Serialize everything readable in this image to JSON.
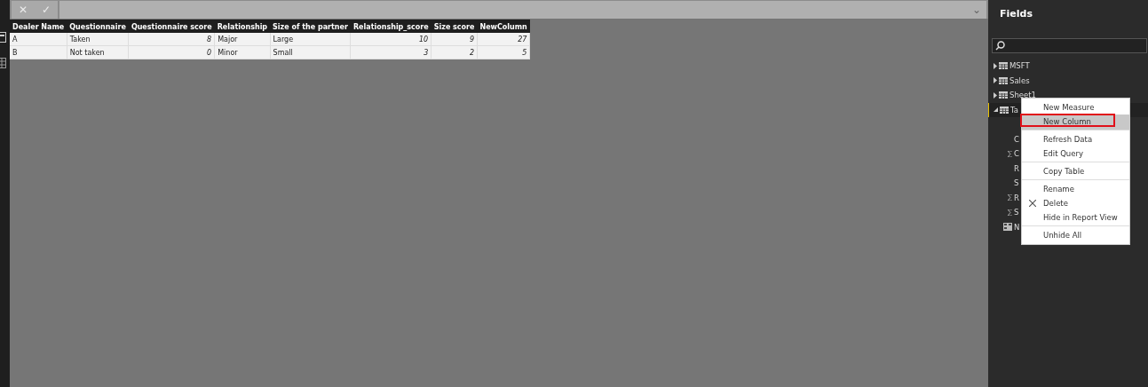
{
  "formula_bar": {
    "cancel": "✕",
    "commit": "✓",
    "expand": "⌄"
  },
  "table": {
    "columns": [
      {
        "label": "Dealer Name",
        "numeric": false
      },
      {
        "label": "Questionnaire",
        "numeric": false
      },
      {
        "label": "Questionnaire score",
        "numeric": true
      },
      {
        "label": "Relationship",
        "numeric": false
      },
      {
        "label": "Size of the partner",
        "numeric": false
      },
      {
        "label": "Relationship_score",
        "numeric": true
      },
      {
        "label": "Size score",
        "numeric": true
      },
      {
        "label": "NewColumn",
        "numeric": true
      }
    ],
    "rows": [
      [
        "A",
        "Taken",
        "8",
        "Major",
        "Large",
        "10",
        "9",
        "27"
      ],
      [
        "B",
        "Not taken",
        "0",
        "Minor",
        "Small",
        "3",
        "2",
        "5"
      ]
    ]
  },
  "fields": {
    "title": "Fields",
    "tables": [
      {
        "label": "MSFT",
        "expanded": false,
        "selected": false
      },
      {
        "label": "Sales",
        "expanded": false,
        "selected": false
      },
      {
        "label": "Sheet1",
        "expanded": false,
        "selected": false
      },
      {
        "label": "Ta",
        "expanded": true,
        "selected": true,
        "children": [
          {
            "label": "C",
            "kind": "text"
          },
          {
            "label": "C",
            "kind": "sum"
          },
          {
            "label": "R",
            "kind": "text"
          },
          {
            "label": "S",
            "kind": "text"
          },
          {
            "label": "R",
            "kind": "sum"
          },
          {
            "label": "S",
            "kind": "sum"
          },
          {
            "label": "N",
            "kind": "measure"
          }
        ]
      }
    ]
  },
  "context_menu": {
    "items": [
      {
        "label": "New Measure",
        "selected": false,
        "highlighted": false,
        "kind": "plain",
        "separator_after": false
      },
      {
        "label": "New Column",
        "selected": true,
        "highlighted": true,
        "kind": "plain",
        "separator_after": true
      },
      {
        "label": "Refresh Data",
        "selected": false,
        "highlighted": false,
        "kind": "plain",
        "separator_after": false
      },
      {
        "label": "Edit Query",
        "selected": false,
        "highlighted": false,
        "kind": "plain",
        "separator_after": true
      },
      {
        "label": "Copy Table",
        "selected": false,
        "highlighted": false,
        "kind": "plain",
        "separator_after": true
      },
      {
        "label": "Rename",
        "selected": false,
        "highlighted": false,
        "kind": "plain",
        "separator_after": false
      },
      {
        "label": "Delete",
        "selected": false,
        "highlighted": false,
        "kind": "delete",
        "separator_after": false
      },
      {
        "label": "Hide in Report View",
        "selected": false,
        "highlighted": false,
        "kind": "plain",
        "separator_after": true
      },
      {
        "label": "Unhide All",
        "selected": false,
        "highlighted": false,
        "kind": "plain",
        "separator_after": false
      }
    ]
  }
}
